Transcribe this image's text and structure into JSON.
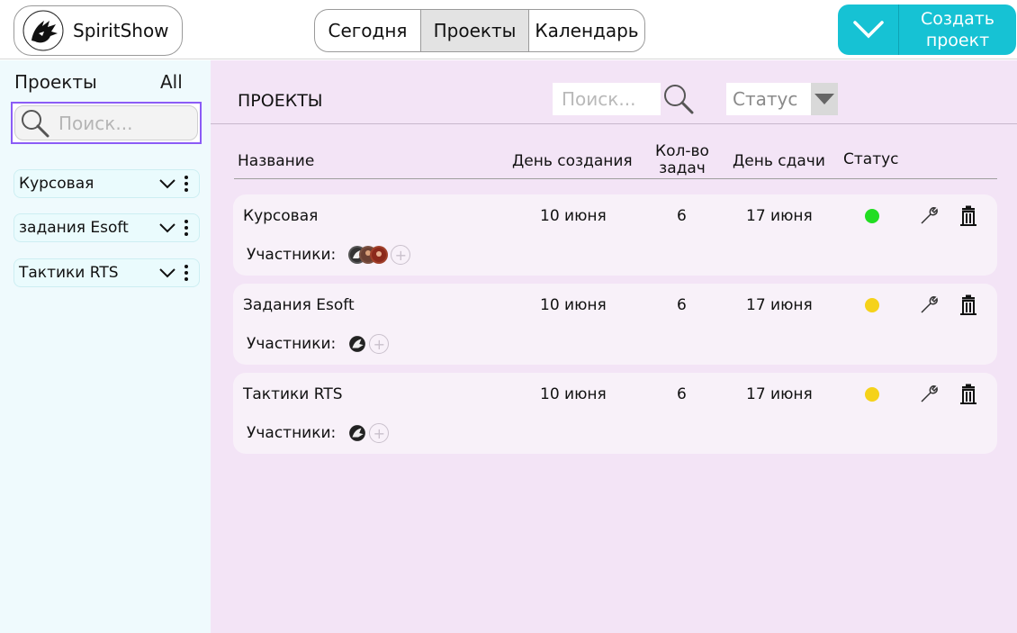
{
  "app": {
    "name": "SpiritShow"
  },
  "nav": {
    "tabs": [
      {
        "label": "Сегодня",
        "active": false
      },
      {
        "label": "Проекты",
        "active": true
      },
      {
        "label": "Календарь",
        "active": false
      }
    ]
  },
  "create_button": {
    "line1": "Создать",
    "line2": "проект"
  },
  "sidebar": {
    "title": "Проекты",
    "filter": "All",
    "search_placeholder": "Поиск...",
    "items": [
      {
        "label": "Курсовая"
      },
      {
        "label": "задания Esoft"
      },
      {
        "label": "Тактики RTS"
      }
    ]
  },
  "main": {
    "title": "ПРОЕКТЫ",
    "search_placeholder": "Поиск...",
    "status_filter": "Статус",
    "columns": {
      "name": "Название",
      "created": "День создания",
      "tasks_line1": "Кол-во",
      "tasks_line2": "задач",
      "due": "День сдачи",
      "status": "Статус"
    },
    "participants_label": "Участники:",
    "rows": [
      {
        "name": "Курсовая",
        "created": "10 июня",
        "tasks": "6",
        "due": "17 июня",
        "status_color": "#22dd22"
      },
      {
        "name": "Задания Esoft",
        "created": "10 июня",
        "tasks": "6",
        "due": "17 июня",
        "status_color": "#f5d21a"
      },
      {
        "name": "Тактики RTS",
        "created": "10 июня",
        "tasks": "6",
        "due": "17 июня",
        "status_color": "#f5d21a"
      }
    ]
  },
  "colors": {
    "accent": "#16c2d4",
    "sidebar_bg": "#effafd",
    "main_bg": "#f3e4f6",
    "focus_border": "#8b5cf6"
  }
}
